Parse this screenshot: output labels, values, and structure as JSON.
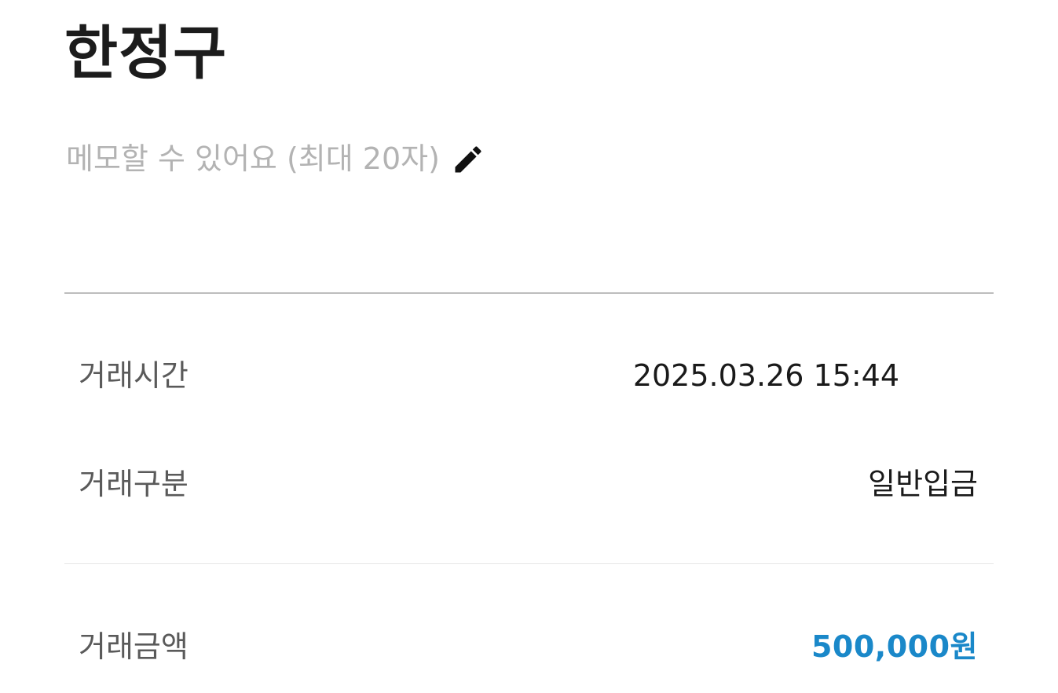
{
  "header": {
    "name": "한정구"
  },
  "memo": {
    "placeholder": "메모할 수 있어요 (최대 20자)",
    "edit_icon": "pencil-icon"
  },
  "details": {
    "time_label": "거래시간",
    "time_value": "2025.03.26 15:44",
    "type_label": "거래구분",
    "type_value": "일반입금",
    "amount_label": "거래금액",
    "amount_value": "500,000원"
  },
  "colors": {
    "amount": "#1a88c9",
    "placeholder": "#b3b3b3",
    "label": "#5a5a5a"
  }
}
